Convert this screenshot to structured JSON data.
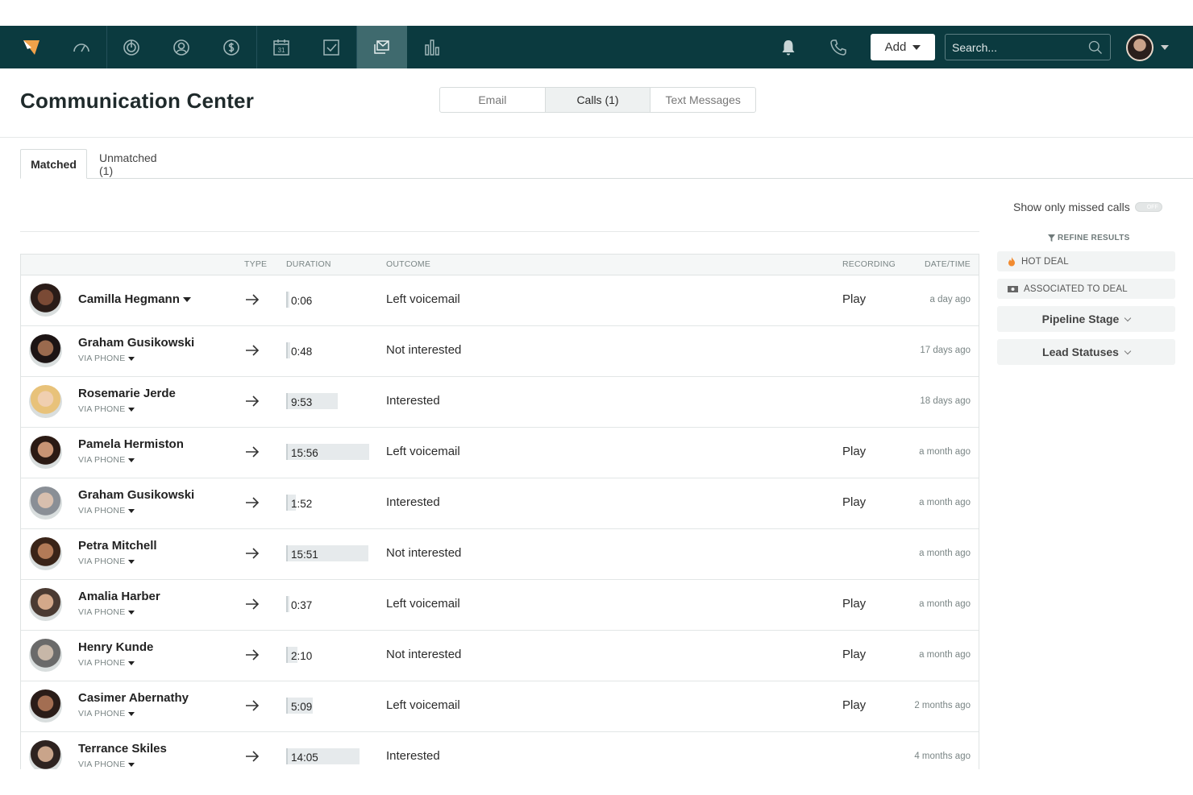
{
  "nav": {
    "icons": [
      "logo-icon",
      "dashboard-icon",
      "leads-icon",
      "contacts-icon",
      "deals-icon",
      "calendar-icon",
      "tasks-icon",
      "communication-icon",
      "reports-icon",
      "bell-icon",
      "phone-icon"
    ],
    "active": "communication-icon",
    "calendar_day": "31",
    "add_label": "Add",
    "search_placeholder": "Search..."
  },
  "header": {
    "title": "Communication Center",
    "channels": [
      "Email",
      "Calls (1)",
      "Text Messages"
    ],
    "active_channel": "Calls (1)"
  },
  "tabs": {
    "matched": "Matched",
    "unmatched": "Unmatched (1)"
  },
  "table": {
    "columns": {
      "type": "TYPE",
      "duration": "DURATION",
      "outcome": "OUTCOME",
      "recording": "RECORDING",
      "datetime": "DATE/TIME"
    },
    "rows": [
      {
        "name": "Camilla Hegmann",
        "via": "",
        "duration": "0:06",
        "duration_fraction": 0.01,
        "outcome": "Left voicemail",
        "recording": "Play",
        "date": "a day ago",
        "avatar_skin": "#7a4a35",
        "avatar_hair": "#2a1c18"
      },
      {
        "name": "Graham Gusikowski",
        "via": "VIA PHONE",
        "duration": "0:48",
        "duration_fraction": 0.05,
        "outcome": "Not interested",
        "recording": "",
        "date": "17 days ago",
        "avatar_skin": "#9a6a4e",
        "avatar_hair": "#1c1414"
      },
      {
        "name": "Rosemarie Jerde",
        "via": "VIA PHONE",
        "duration": "9:53",
        "duration_fraction": 0.62,
        "outcome": "Interested",
        "recording": "",
        "date": "18 days ago",
        "avatar_skin": "#f0cfb0",
        "avatar_hair": "#e8c27a"
      },
      {
        "name": "Pamela Hermiston",
        "via": "VIA PHONE",
        "duration": "15:56",
        "duration_fraction": 1.0,
        "outcome": "Left voicemail",
        "recording": "Play",
        "date": "a month ago",
        "avatar_skin": "#c99474",
        "avatar_hair": "#2b1a14"
      },
      {
        "name": "Graham Gusikowski",
        "via": "VIA PHONE",
        "duration": "1:52",
        "duration_fraction": 0.12,
        "outcome": "Interested",
        "recording": "Play",
        "date": "a month ago",
        "avatar_skin": "#d8bfae",
        "avatar_hair": "#8a8f96"
      },
      {
        "name": "Petra Mitchell",
        "via": "VIA PHONE",
        "duration": "15:51",
        "duration_fraction": 0.99,
        "outcome": "Not interested",
        "recording": "",
        "date": "a month ago",
        "avatar_skin": "#b27a57",
        "avatar_hair": "#3a2418"
      },
      {
        "name": "Amalia Harber",
        "via": "VIA PHONE",
        "duration": "0:37",
        "duration_fraction": 0.04,
        "outcome": "Left voicemail",
        "recording": "Play",
        "date": "a month ago",
        "avatar_skin": "#d3a88a",
        "avatar_hair": "#4a3a32"
      },
      {
        "name": "Henry Kunde",
        "via": "VIA PHONE",
        "duration": "2:10",
        "duration_fraction": 0.14,
        "outcome": "Not interested",
        "recording": "Play",
        "date": "a month ago",
        "avatar_skin": "#c7b7a8",
        "avatar_hair": "#6a6a6a"
      },
      {
        "name": "Casimer Abernathy",
        "via": "VIA PHONE",
        "duration": "5:09",
        "duration_fraction": 0.32,
        "outcome": "Left voicemail",
        "recording": "Play",
        "date": "2 months ago",
        "avatar_skin": "#a36e52",
        "avatar_hair": "#2a1c18"
      },
      {
        "name": "Terrance Skiles",
        "via": "VIA PHONE",
        "duration": "14:05",
        "duration_fraction": 0.88,
        "outcome": "Interested",
        "recording": "",
        "date": "4 months ago",
        "avatar_skin": "#c9a48a",
        "avatar_hair": "#2e2320"
      }
    ]
  },
  "filters": {
    "missed_label": "Show only missed calls",
    "toggle_text": "OFF",
    "refine_label": "REFINE RESULTS",
    "hot_deal": "HOT DEAL",
    "associated": "ASSOCIATED TO DEAL",
    "pipeline_stage": "Pipeline Stage",
    "lead_statuses": "Lead Statuses"
  },
  "colors": {
    "nav_bg": "#0b3a3f",
    "nav_active": "#3f6a6e",
    "accent_hot": "#f28b30"
  }
}
